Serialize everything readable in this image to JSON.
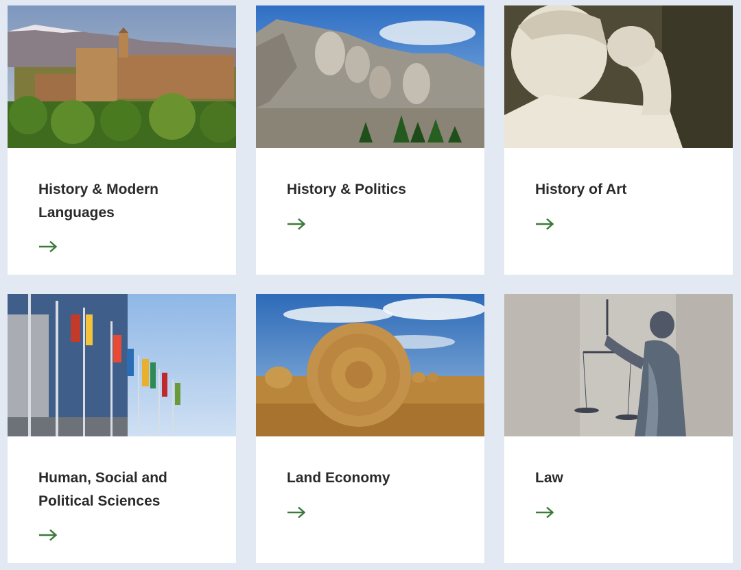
{
  "cards": [
    {
      "title": "History & Modern Languages",
      "image": "alhambra-palace-photo"
    },
    {
      "title": "History & Politics",
      "image": "mount-rushmore-photo"
    },
    {
      "title": "History of Art",
      "image": "david-statue-photo"
    },
    {
      "title": "Human, Social and Political Sciences",
      "image": "flags-building-photo"
    },
    {
      "title": "Land Economy",
      "image": "hay-bale-field-photo"
    },
    {
      "title": "Law",
      "image": "lady-justice-statue-photo"
    }
  ],
  "arrow_icon": "arrow-right-icon",
  "colors": {
    "background": "#e2e9f2",
    "card": "#ffffff",
    "title": "#2a2a2a",
    "arrow": "#3d7a3a"
  }
}
